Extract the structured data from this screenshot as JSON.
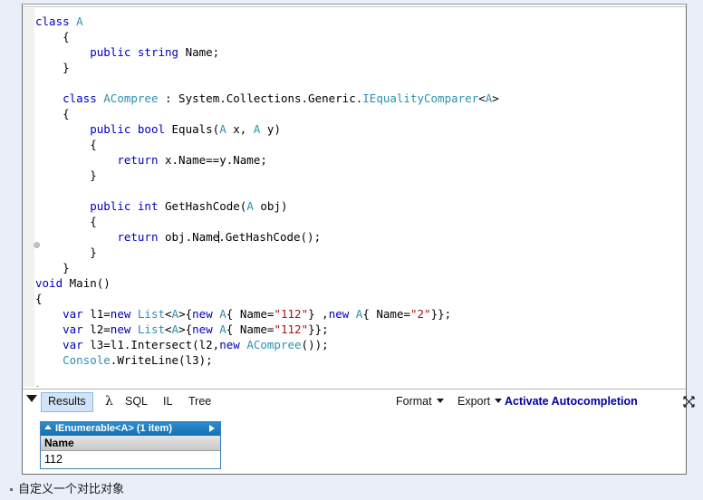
{
  "window": {
    "background_color": "#e9eef8",
    "pane_border_color": "#6e6e6e"
  },
  "editor": {
    "font": "monospace",
    "colors": {
      "keyword": "#0000c0",
      "type": "#2b91af",
      "string": "#a31515",
      "plain": "#000000"
    },
    "lines": [
      [
        {
          "t": "class ",
          "c": "kw"
        },
        {
          "t": "A",
          "c": "typ"
        }
      ],
      [
        {
          "t": "    {",
          "c": "pl"
        }
      ],
      [
        {
          "t": "        ",
          "c": "pl"
        },
        {
          "t": "public string ",
          "c": "kw"
        },
        {
          "t": "Name;",
          "c": "pl"
        }
      ],
      [
        {
          "t": "    }",
          "c": "pl"
        }
      ],
      [
        {
          "t": "",
          "c": "pl"
        }
      ],
      [
        {
          "t": "    ",
          "c": "pl"
        },
        {
          "t": "class ",
          "c": "kw"
        },
        {
          "t": "ACompree",
          "c": "typ"
        },
        {
          "t": " : System.Collections.Generic.",
          "c": "pl"
        },
        {
          "t": "IEqualityComparer",
          "c": "typ"
        },
        {
          "t": "<",
          "c": "pl"
        },
        {
          "t": "A",
          "c": "typ"
        },
        {
          "t": ">",
          "c": "pl"
        }
      ],
      [
        {
          "t": "    {",
          "c": "pl"
        }
      ],
      [
        {
          "t": "        ",
          "c": "pl"
        },
        {
          "t": "public bool ",
          "c": "kw"
        },
        {
          "t": "Equals(",
          "c": "pl"
        },
        {
          "t": "A",
          "c": "typ"
        },
        {
          "t": " x, ",
          "c": "pl"
        },
        {
          "t": "A",
          "c": "typ"
        },
        {
          "t": " y)",
          "c": "pl"
        }
      ],
      [
        {
          "t": "        {",
          "c": "pl"
        }
      ],
      [
        {
          "t": "            ",
          "c": "pl"
        },
        {
          "t": "return ",
          "c": "kw"
        },
        {
          "t": "x.Name==y.Name;",
          "c": "pl"
        }
      ],
      [
        {
          "t": "        }",
          "c": "pl"
        }
      ],
      [
        {
          "t": "",
          "c": "pl"
        }
      ],
      [
        {
          "t": "        ",
          "c": "pl"
        },
        {
          "t": "public int ",
          "c": "kw"
        },
        {
          "t": "GetHashCode(",
          "c": "pl"
        },
        {
          "t": "A",
          "c": "typ"
        },
        {
          "t": " obj)",
          "c": "pl"
        }
      ],
      [
        {
          "t": "        {",
          "c": "pl"
        }
      ],
      [
        {
          "t": "            ",
          "c": "pl"
        },
        {
          "t": "return ",
          "c": "kw"
        },
        {
          "t": "obj.Name",
          "c": "pl"
        },
        {
          "t": "",
          "c": "cursor"
        },
        {
          "t": ".GetHashCode();",
          "c": "pl"
        }
      ],
      [
        {
          "t": "        }",
          "c": "pl"
        }
      ],
      [
        {
          "t": "    }",
          "c": "pl"
        }
      ],
      [
        {
          "t": "void ",
          "c": "kw"
        },
        {
          "t": "Main()",
          "c": "pl"
        }
      ],
      [
        {
          "t": "{",
          "c": "pl"
        }
      ],
      [
        {
          "t": "    ",
          "c": "pl"
        },
        {
          "t": "var ",
          "c": "kw"
        },
        {
          "t": "l1=",
          "c": "pl"
        },
        {
          "t": "new ",
          "c": "kw"
        },
        {
          "t": "List",
          "c": "typ"
        },
        {
          "t": "<",
          "c": "pl"
        },
        {
          "t": "A",
          "c": "typ"
        },
        {
          "t": ">{",
          "c": "pl"
        },
        {
          "t": "new ",
          "c": "kw"
        },
        {
          "t": "A",
          "c": "typ"
        },
        {
          "t": "{ Name=",
          "c": "pl"
        },
        {
          "t": "\"112\"",
          "c": "str"
        },
        {
          "t": "} ,",
          "c": "pl"
        },
        {
          "t": "new ",
          "c": "kw"
        },
        {
          "t": "A",
          "c": "typ"
        },
        {
          "t": "{ Name=",
          "c": "pl"
        },
        {
          "t": "\"2\"",
          "c": "str"
        },
        {
          "t": "}};",
          "c": "pl"
        }
      ],
      [
        {
          "t": "    ",
          "c": "pl"
        },
        {
          "t": "var ",
          "c": "kw"
        },
        {
          "t": "l2=",
          "c": "pl"
        },
        {
          "t": "new ",
          "c": "kw"
        },
        {
          "t": "List",
          "c": "typ"
        },
        {
          "t": "<",
          "c": "pl"
        },
        {
          "t": "A",
          "c": "typ"
        },
        {
          "t": ">{",
          "c": "pl"
        },
        {
          "t": "new ",
          "c": "kw"
        },
        {
          "t": "A",
          "c": "typ"
        },
        {
          "t": "{ Name=",
          "c": "pl"
        },
        {
          "t": "\"112\"",
          "c": "str"
        },
        {
          "t": "}};",
          "c": "pl"
        }
      ],
      [
        {
          "t": "    ",
          "c": "pl"
        },
        {
          "t": "var ",
          "c": "kw"
        },
        {
          "t": "l3=l1.Intersect(l2,",
          "c": "pl"
        },
        {
          "t": "new ",
          "c": "kw"
        },
        {
          "t": "ACompree",
          "c": "typ"
        },
        {
          "t": "());",
          "c": "pl"
        }
      ],
      [
        {
          "t": "    ",
          "c": "pl"
        },
        {
          "t": "Console",
          "c": "typ"
        },
        {
          "t": ".WriteLine(l3);",
          "c": "pl"
        }
      ],
      [
        {
          "t": "",
          "c": "pl"
        }
      ],
      [
        {
          "t": "}",
          "c": "pl"
        }
      ]
    ]
  },
  "results_bar": {
    "collapse_icon": "triangle-down-icon",
    "tabs": [
      {
        "label": "Results",
        "active": true
      },
      {
        "label": "λ",
        "active": false
      },
      {
        "label": "SQL",
        "active": false
      },
      {
        "label": "IL",
        "active": false
      },
      {
        "label": "Tree",
        "active": false
      }
    ],
    "format_label": "Format",
    "export_label": "Export",
    "autocomplete_label": "Activate Autocompletion",
    "autocomplete_color": "#00009c",
    "expand_all_icon": "expand-all-icon",
    "overflow_icon": "❯"
  },
  "results_grid": {
    "title": "IEnumerable<A> (1 item)",
    "title_bg": "#1d7ec4",
    "columns": [
      "Name"
    ],
    "rows": [
      [
        "112"
      ]
    ]
  },
  "status": {
    "text": "自定义一个对比对象"
  }
}
